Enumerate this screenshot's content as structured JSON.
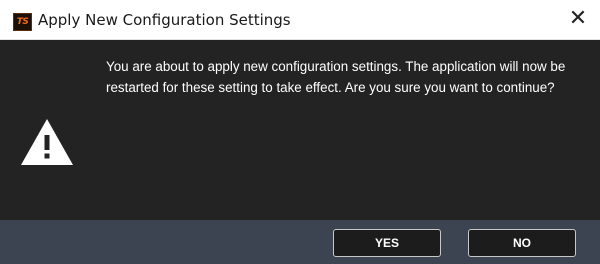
{
  "window": {
    "title": "Apply New Configuration Settings",
    "app_icon_text": "TS",
    "close_glyph": "✕"
  },
  "dialog": {
    "icon": "warning-icon",
    "message": "You are about to apply new configuration settings. The application will now be restarted for these setting to take effect. Are you sure you want to continue?"
  },
  "buttons": {
    "yes_label": "YES",
    "no_label": "NO"
  },
  "colors": {
    "body_bg": "#232323",
    "footer_bg": "#3d4451",
    "button_bg": "#1c1c1c",
    "text": "#ffffff"
  }
}
